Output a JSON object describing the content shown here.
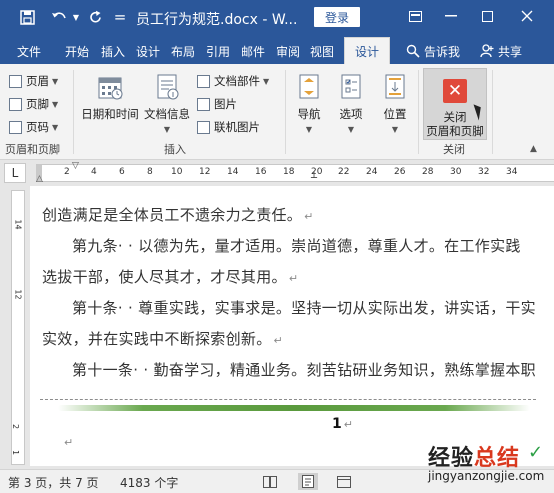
{
  "titlebar": {
    "title": "员工行为规范.docx - W...",
    "login": "登录",
    "customize_glyph": "="
  },
  "tabs": [
    {
      "label": "文件"
    },
    {
      "label": "开始"
    },
    {
      "label": "插入"
    },
    {
      "label": "设计"
    },
    {
      "label": "布局"
    },
    {
      "label": "引用"
    },
    {
      "label": "邮件"
    },
    {
      "label": "审阅"
    },
    {
      "label": "视图"
    },
    {
      "label": "设计",
      "active": true
    }
  ],
  "tell_me": "告诉我",
  "share": "共享",
  "ribbon": {
    "header_footer": {
      "items": [
        "页眉",
        "页脚",
        "页码"
      ],
      "label": "页眉和页脚"
    },
    "insert": {
      "date_time": "日期和时间",
      "doc_info": "文档信息",
      "doc_parts": "文档部件",
      "picture": "图片",
      "online_picture": "联机图片",
      "label": "插入"
    },
    "navigation": "导航",
    "options": "选项",
    "position": "位置",
    "close": {
      "line1": "关闭",
      "line2": "页眉和页脚",
      "label": "关闭"
    }
  },
  "ruler": {
    "corner": "L",
    "numbers": [
      "2",
      "4",
      "6",
      "8",
      "10",
      "12",
      "14",
      "16",
      "18",
      "20",
      "22",
      "24",
      "26",
      "28",
      "30",
      "32",
      "34"
    ],
    "vertical_numbers": [
      "14",
      "12",
      "2",
      "1"
    ]
  },
  "document": {
    "lines": [
      "创造满足是全体员工不遗余力之责任。",
      "第九条· · 以德为先，量才适用。崇尚道德，尊重人才。在工作实践",
      "选拔干部，使人尽其才，才尽其用。",
      "第十条· · 尊重实践，实事求是。坚持一切从实际出发，讲实话，干实",
      "实效，并在实践中不断探索创新。",
      "第十一条· · 勤奋学习，精通业务。刻苦钻研业务知识，熟练掌握本职"
    ],
    "paragraph_mark": "↵",
    "page_number": "1"
  },
  "status": {
    "page": "第 3 页，共 7 页",
    "words": "4183 个字"
  },
  "watermark": {
    "title_a": "经验",
    "title_b": "总结",
    "url": "jingyanzongjie.com"
  },
  "colors": {
    "accent": "#2b579a",
    "close_icon": "#e0493a",
    "footer_rule": "#6aa84f"
  }
}
